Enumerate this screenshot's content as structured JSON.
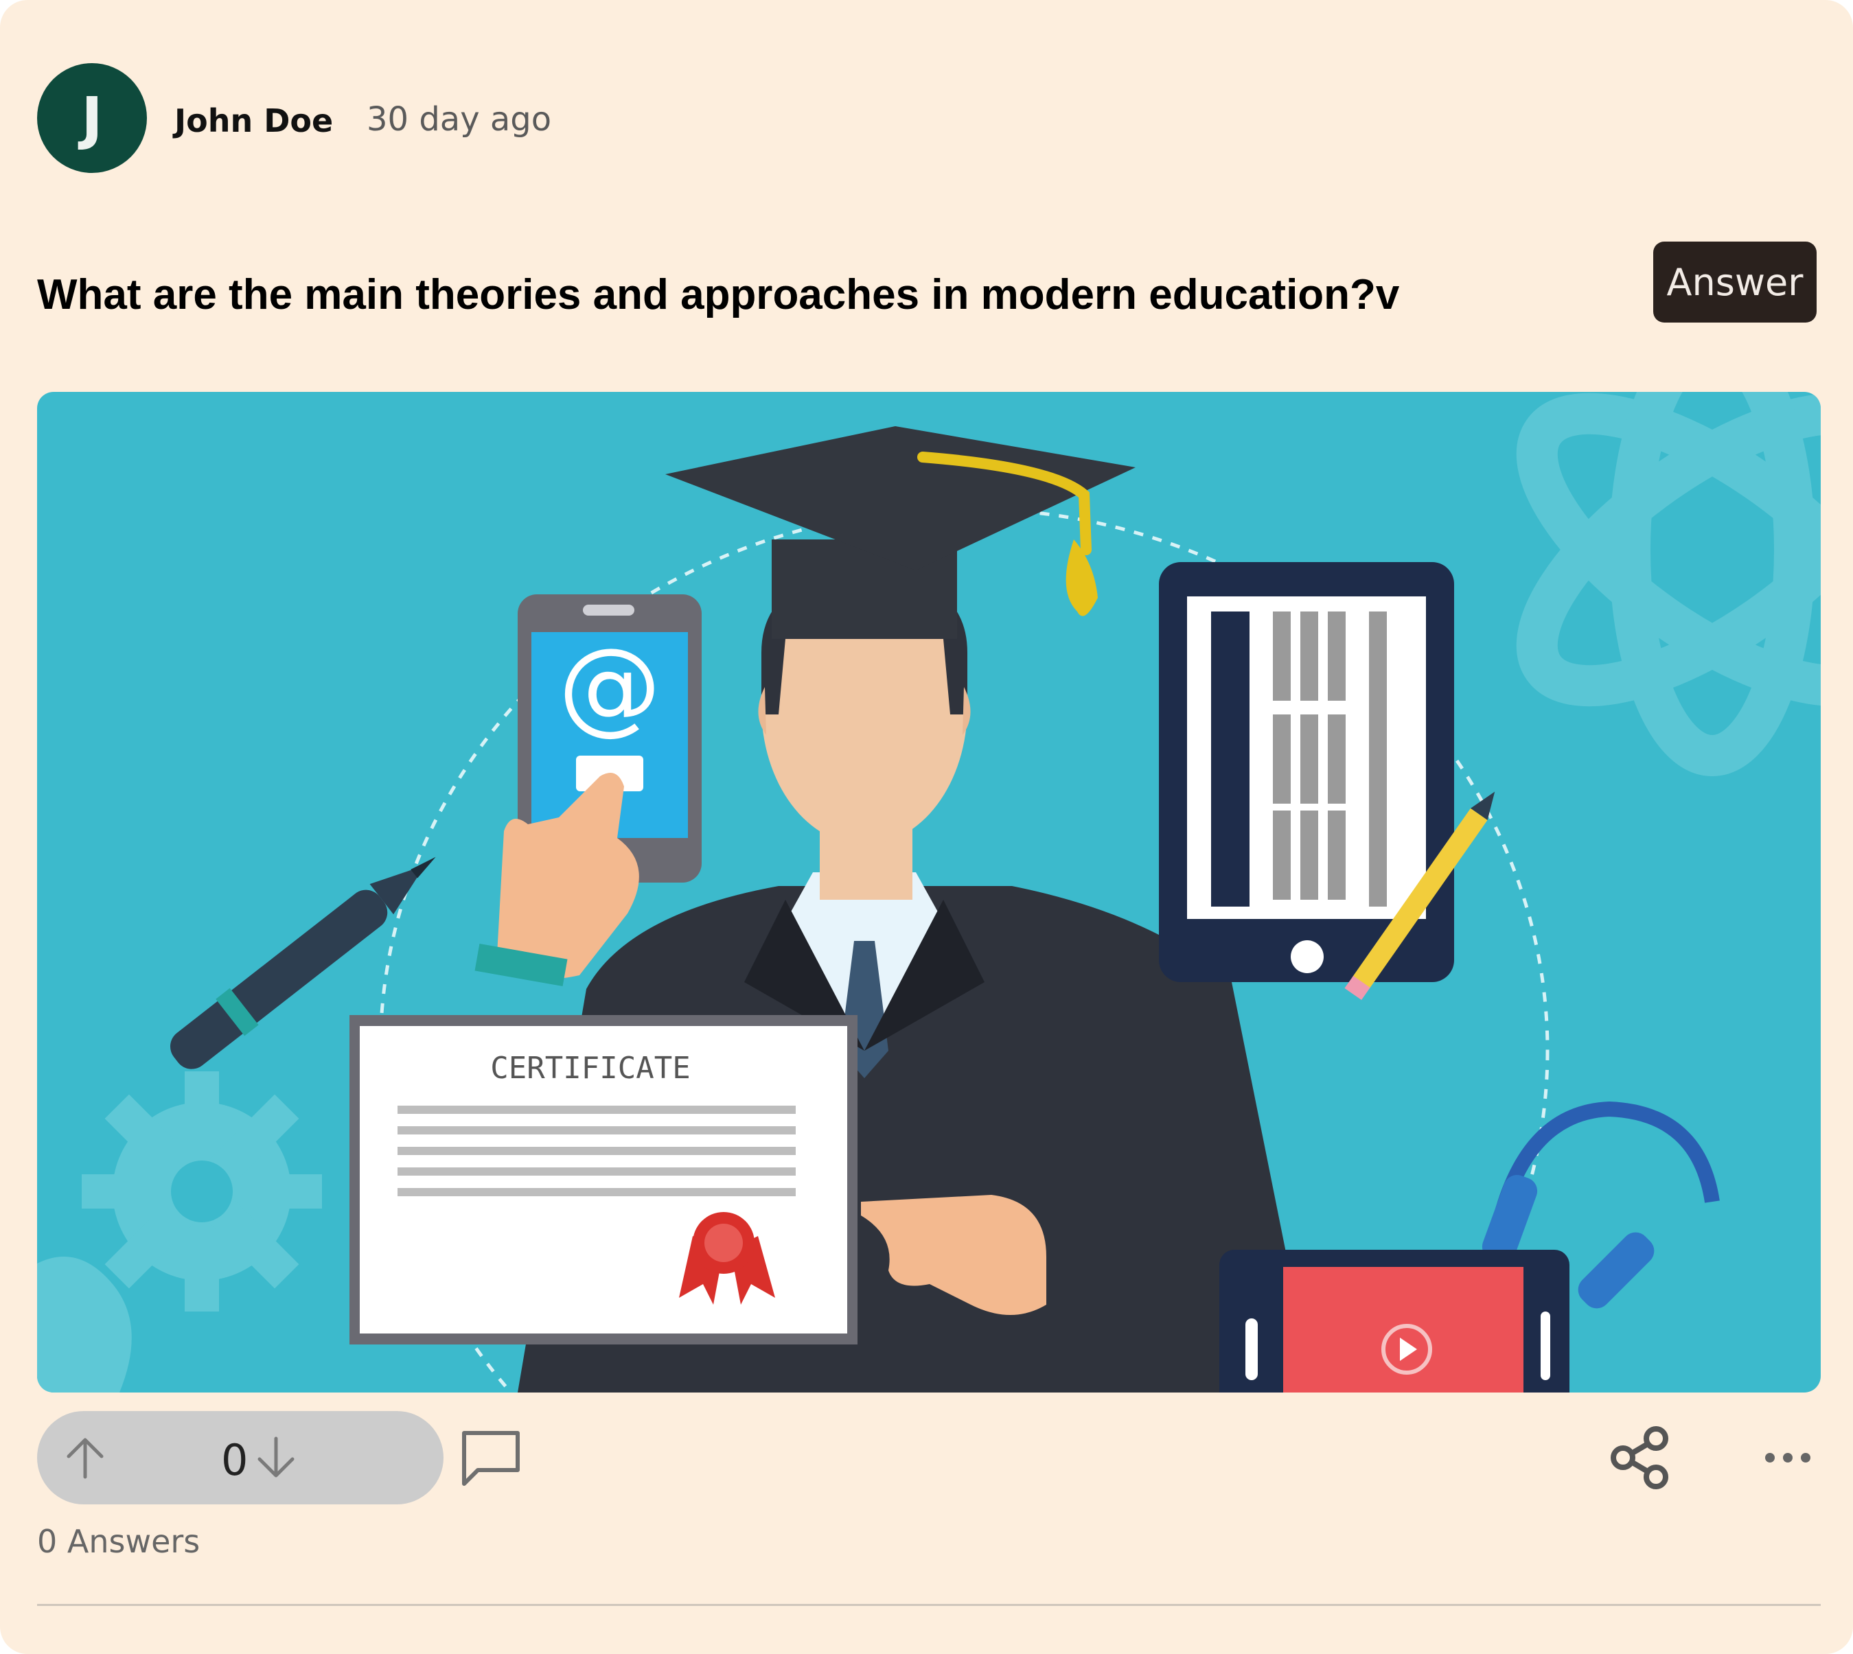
{
  "post": {
    "avatar_initial": "J",
    "author": "John Doe",
    "timestamp": "30 day ago",
    "question": "What are the main theories and approaches in modern education?v",
    "answer_button": "Answer",
    "image": {
      "certificate_text": "CERTIFICATE",
      "at_symbol": "@"
    },
    "votes": {
      "count": "0"
    },
    "answers_label": "0 Answers"
  },
  "colors": {
    "card_background": "#fdeedd",
    "avatar_background": "#0e4a3c",
    "answer_button": "#2a211d",
    "hero_background": "#3cbacc",
    "vote_pill": "#cccccc"
  },
  "icons": [
    "arrow-up-icon",
    "arrow-down-icon",
    "comment-icon",
    "share-icon",
    "more-icon"
  ]
}
